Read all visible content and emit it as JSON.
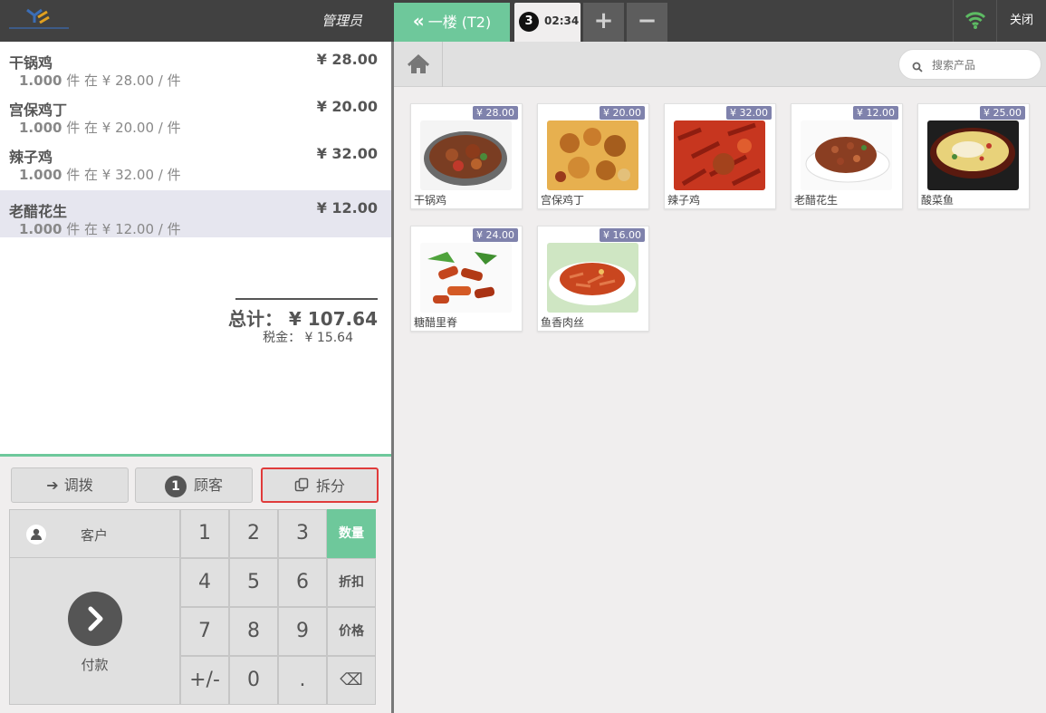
{
  "header": {
    "username": "管理员",
    "order_main_tab": "一楼 (T2)",
    "order_tab": {
      "badge": "3",
      "time": "02:34"
    },
    "add_label": "+",
    "remove_label": "−",
    "close_label": "关闭",
    "wifi_color": "#5dbb63"
  },
  "orderlines": [
    {
      "name": "干锅鸡",
      "price": "¥ 28.00",
      "qty": "1.000",
      "info": "件 在 ¥ 28.00 / 件"
    },
    {
      "name": "宫保鸡丁",
      "price": "¥ 20.00",
      "qty": "1.000",
      "info": "件 在 ¥ 20.00 / 件"
    },
    {
      "name": "辣子鸡",
      "price": "¥ 32.00",
      "qty": "1.000",
      "info": "件 在 ¥ 32.00 / 件"
    },
    {
      "name": "老醋花生",
      "price": "¥ 12.00",
      "qty": "1.000",
      "info": "件 在 ¥ 12.00 / 件"
    }
  ],
  "summary": {
    "total": "总计：  ¥ 107.64",
    "tax": "税金：  ¥ 15.64"
  },
  "controls": {
    "transfer_label": "调拨",
    "guests_count": "1",
    "guests_label": "顾客",
    "split_label": "拆分",
    "customer_label": "客户",
    "payment_label": "付款"
  },
  "keypad": {
    "digits": [
      "1",
      "2",
      "3",
      "4",
      "5",
      "6",
      "7",
      "8",
      "9",
      "+/-",
      "0",
      "."
    ],
    "modes": [
      "数量",
      "折扣",
      "价格"
    ],
    "backspace": "⌫"
  },
  "search": {
    "placeholder": "搜索产品"
  },
  "products": [
    {
      "name": "干锅鸡",
      "price": "¥ 28.00"
    },
    {
      "name": "宫保鸡丁",
      "price": "¥ 20.00"
    },
    {
      "name": "辣子鸡",
      "price": "¥ 32.00"
    },
    {
      "name": "老醋花生",
      "price": "¥ 12.00"
    },
    {
      "name": "酸菜鱼",
      "price": "¥ 25.00"
    },
    {
      "name": "糖醋里脊",
      "price": "¥ 24.00"
    },
    {
      "name": "鱼香肉丝",
      "price": "¥ 16.00"
    }
  ]
}
